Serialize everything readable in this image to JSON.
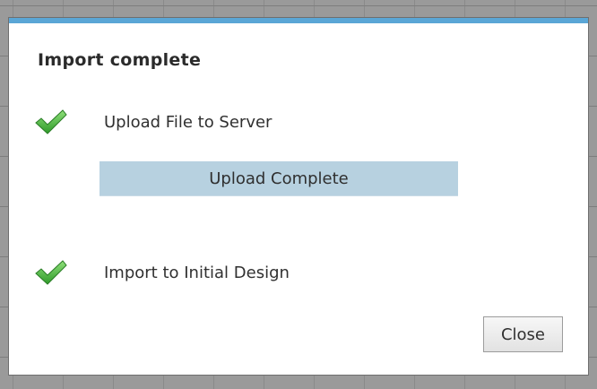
{
  "dialog": {
    "title": "Import complete",
    "steps": [
      {
        "label": "Upload File to Server",
        "status_icon": "checkmark-icon",
        "progress_text": "Upload Complete"
      },
      {
        "label": "Import to Initial Design",
        "status_icon": "checkmark-icon"
      }
    ],
    "close_label": "Close"
  },
  "colors": {
    "title_bar_accent": "#5aa6d6",
    "progress_fill": "#b7d1e0",
    "check_green": "#4caf3c"
  }
}
